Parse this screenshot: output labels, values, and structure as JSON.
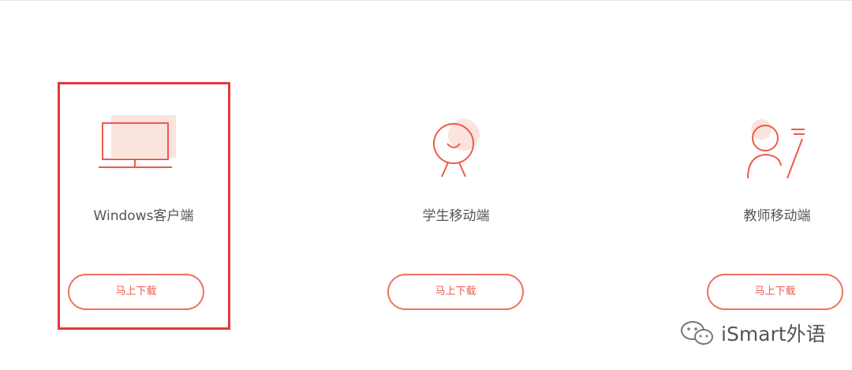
{
  "colors": {
    "accent": "#ef5a4a",
    "accent_light": "#fbe3de",
    "selection_border": "#e5363c"
  },
  "cards": [
    {
      "label": "Windows客户端",
      "icon": "monitor-icon",
      "button_label": "马上下载",
      "selected": true
    },
    {
      "label": "学生移动端",
      "icon": "student-icon",
      "button_label": "马上下载",
      "selected": false
    },
    {
      "label": "教师移动端",
      "icon": "teacher-icon",
      "button_label": "马上下载",
      "selected": false
    }
  ],
  "watermark": {
    "text": "iSmart外语",
    "icon": "wechat-icon"
  }
}
